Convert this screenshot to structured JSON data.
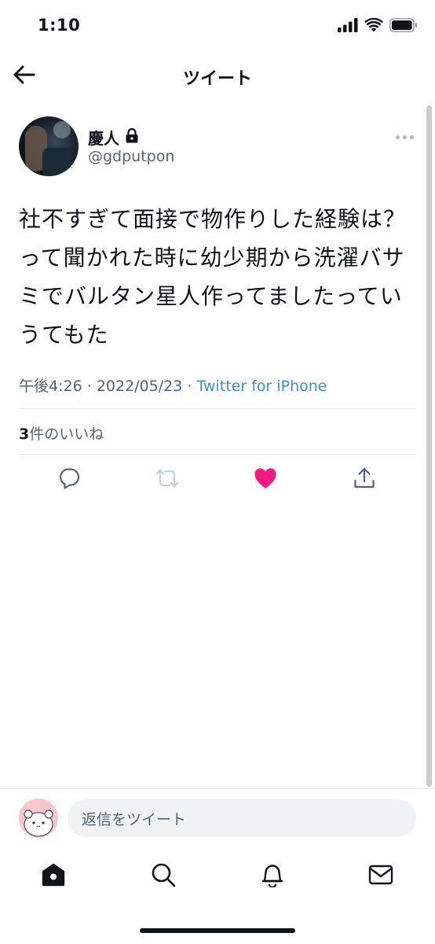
{
  "status_bar": {
    "time": "1:10"
  },
  "header": {
    "title": "ツイート"
  },
  "tweet": {
    "author_name": "慶人",
    "author_handle": "@gdputpon",
    "text": "社不すぎて面接で物作りした経験は？って聞かれた時に幼少期から洗濯バサミでバルタン星人作ってましたっていうてもた",
    "time": "午後4:26",
    "date": "2022/05/23",
    "separator": "·",
    "source": "Twitter for iPhone",
    "like_count": "3",
    "like_label": "件のいいね"
  },
  "reply": {
    "placeholder": "返信をツイート"
  },
  "colors": {
    "accent": "#1d9bf0",
    "source_link": "#3b8ed0",
    "like_active": "#f91880",
    "muted_text": "#536471"
  },
  "icons": {
    "status": [
      "cellular-signal-icon",
      "wifi-icon",
      "battery-icon"
    ],
    "actions": [
      "reply-icon",
      "retweet-icon",
      "like-icon",
      "share-icon"
    ],
    "tabs": [
      "home-icon",
      "search-icon",
      "notifications-icon",
      "messages-icon"
    ]
  }
}
